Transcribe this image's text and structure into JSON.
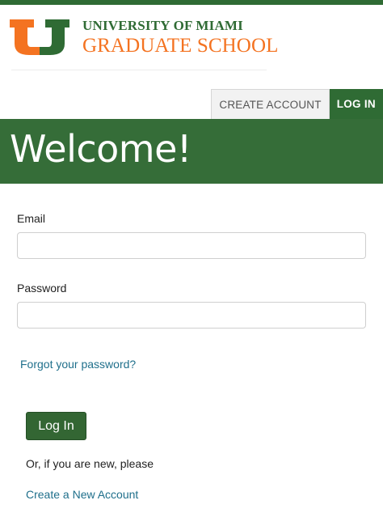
{
  "logo": {
    "line1": "UNIVERSITY OF MIAMI",
    "line2": "GRADUATE SCHOOL",
    "colors": {
      "orange": "#f47321",
      "green": "#2f6b34"
    }
  },
  "tabs": [
    {
      "label": "CREATE ACCOUNT"
    },
    {
      "label": "LOG IN"
    }
  ],
  "banner": {
    "title": "Welcome!"
  },
  "form": {
    "email_label": "Email",
    "email_value": "",
    "password_label": "Password",
    "password_value": "",
    "forgot_link": "Forgot your password?",
    "login_button": "Log In",
    "new_user_text": "Or, if you are new, please",
    "create_link": "Create a New Account"
  }
}
